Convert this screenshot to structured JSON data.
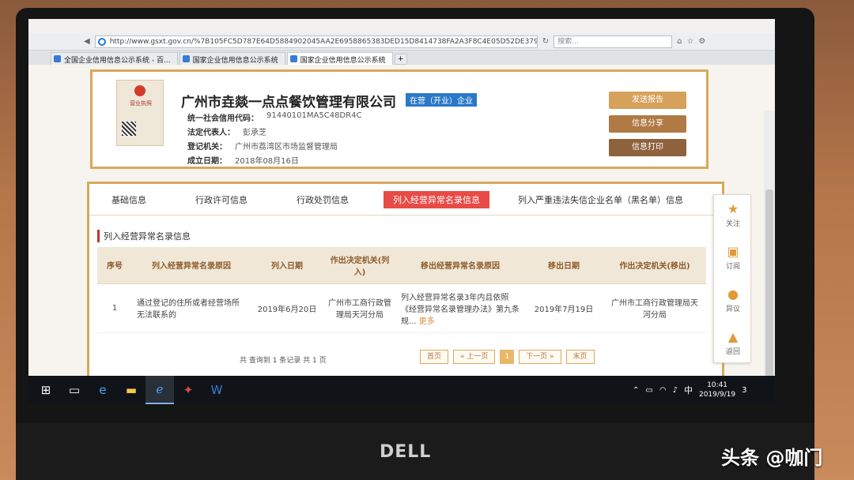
{
  "browser": {
    "url": "http://www.gsxt.gov.cn/%7B105FC5D787E64D5884902045AA2E6958865383DED15D8414738FA2A3F8C4E05D52DE3797F9",
    "search_placeholder": "搜索...",
    "tabs": [
      {
        "label": "全国企业信用信息公示系统 - 百..."
      },
      {
        "label": "国家企业信用信息公示系统"
      },
      {
        "label": "国家企业信用信息公示系统"
      }
    ]
  },
  "company": {
    "license_image_text": "营业执照",
    "name": "广州市垚燚一点点餐饮管理有限公司",
    "status": "在营（开业）企业",
    "fields": [
      {
        "label": "统一社会信用代码：",
        "value": "91440101MA5C48DR4C"
      },
      {
        "label": "法定代表人：",
        "value": "彭承芝"
      },
      {
        "label": "登记机关：",
        "value": "广州市荔湾区市场监督管理局"
      },
      {
        "label": "成立日期：",
        "value": "2018年08月16日"
      }
    ],
    "buttons": {
      "report": "发送报告",
      "share": "信息分享",
      "print": "信息打印"
    }
  },
  "detail_tabs": [
    {
      "label": "基础信息",
      "active": false
    },
    {
      "label": "行政许可信息",
      "active": false
    },
    {
      "label": "行政处罚信息",
      "active": false
    },
    {
      "label": "列入经营异常名录信息",
      "active": true
    },
    {
      "label": "列入严重违法失信企业名单（黑名单）信息",
      "active": false
    }
  ],
  "section_title": "列入经营异常名录信息",
  "table": {
    "headers": [
      "序号",
      "列入经营异常名录原因",
      "列入日期",
      "作出决定机关(列入)",
      "移出经营异常名录原因",
      "移出日期",
      "作出决定机关(移出)"
    ],
    "rows": [
      {
        "no": "1",
        "reason": "通过登记的住所或者经营场所无法联系的",
        "date_in": "2019年6月20日",
        "authority_in": "广州市工商行政管理局天河分局",
        "remove_reason": "列入经营异常名录3年内且依照《经营异常名录管理办法》第九条规...",
        "more": "更多",
        "date_out": "2019年7月19日",
        "authority_out": "广州市工商行政管理局天河分局"
      }
    ]
  },
  "pager": {
    "summary": "共 查询到 1 条记录 共 1 页",
    "first": "首页",
    "prev": "« 上一页",
    "current": "1",
    "next": "下一页 »",
    "last": "末页"
  },
  "float_bar": [
    {
      "label": "关注",
      "icon": "star-icon"
    },
    {
      "label": "订阅",
      "icon": "bookmark-icon"
    },
    {
      "label": "异议",
      "icon": "chat-icon"
    },
    {
      "label": "返回",
      "icon": "arrow-up-icon"
    }
  ],
  "taskbar": {
    "time": "10:41",
    "date": "2019/9/19",
    "ime": "中",
    "notifications": "3"
  },
  "overlay": {
    "laptop_brand": "DELL",
    "watermark": "头条 @咖门"
  }
}
